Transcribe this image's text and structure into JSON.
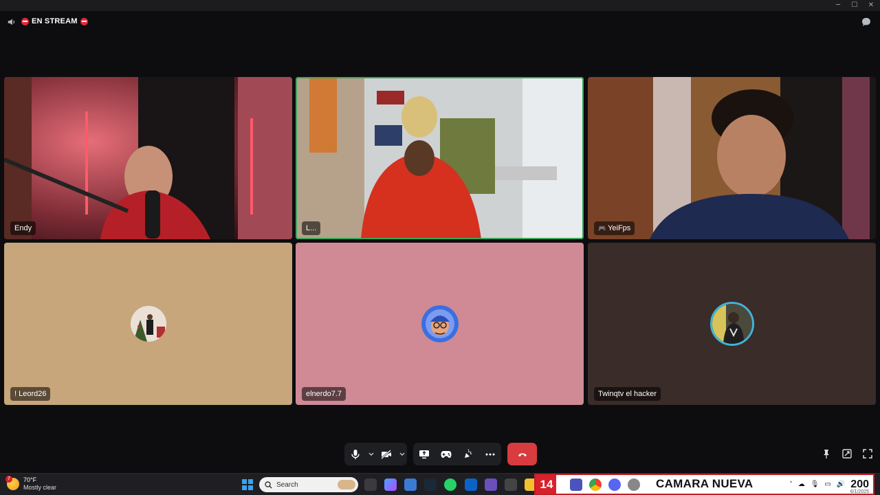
{
  "window": {
    "controls": [
      "─",
      "☐",
      "✕"
    ]
  },
  "header": {
    "title": "EN STREAM"
  },
  "participants": [
    {
      "name": "Endy",
      "type": "video"
    },
    {
      "name": "L...",
      "type": "video",
      "speaking": true
    },
    {
      "name": "YeiFps",
      "type": "video",
      "badge_icon": "gamepad-icon"
    },
    {
      "name": "! Leord26",
      "type": "avatar",
      "tile_color": "#c7a67b"
    },
    {
      "name": "elnerdo7.7",
      "type": "avatar",
      "tile_color": "#cf8a95"
    },
    {
      "name": "Twinqtv el hacker",
      "type": "avatar",
      "tile_color": "#3a2c29"
    }
  ],
  "controls": {
    "buttons": [
      "microphone",
      "camera-off",
      "screen-share",
      "activities",
      "soundboard",
      "more"
    ],
    "end_call_color": "#d83c3e"
  },
  "taskbar": {
    "weather_temp": "70°F",
    "weather_condition": "Mostly clear",
    "weather_badge": "7",
    "search_placeholder": "Search",
    "overlay_number": "14",
    "overlay_title": "CAMARA NUEVA",
    "overlay_count": "200",
    "date": "6/1/2025"
  }
}
